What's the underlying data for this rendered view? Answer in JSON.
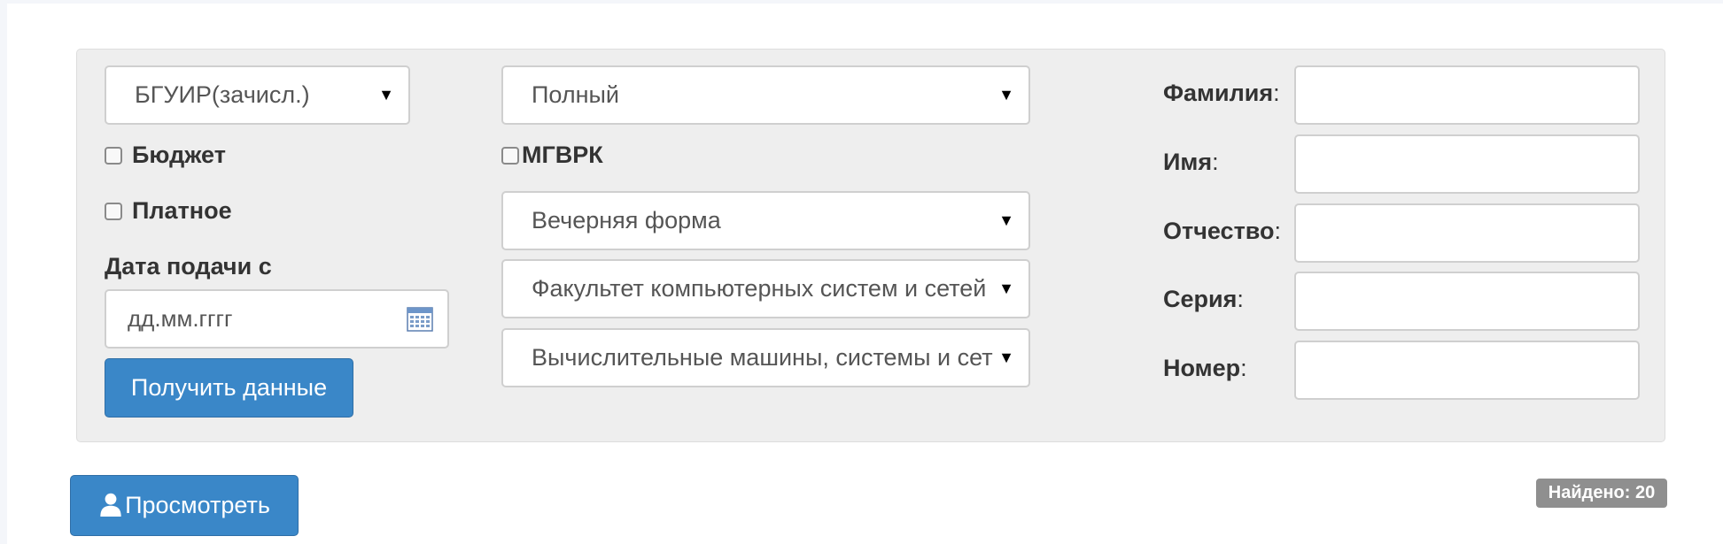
{
  "filters": {
    "institution_select": "БГУИР(зачисл.)",
    "budget_label": "Бюджет",
    "paid_label": "Платное",
    "date_from_label": "Дата подачи с",
    "date_placeholder": "дд.мм.гггг",
    "get_data_button": "Получить данные",
    "mode_select": "Полный",
    "mgvrk_label": "МГВРК",
    "study_form_select": "Вечерняя форма",
    "faculty_select": "Факультет компьютерных систем и сетей",
    "specialty_select": "Вычислительные машины, системы и сети"
  },
  "person_fields": [
    {
      "label": "Фамилия",
      "suffix": ":"
    },
    {
      "label": "Имя",
      "suffix": ":"
    },
    {
      "label": "Отчество",
      "suffix": ":"
    },
    {
      "label": "Серия",
      "suffix": ":"
    },
    {
      "label": "Номер",
      "suffix": ":"
    }
  ],
  "view_button": "Просмотреть",
  "found_badge": "Найдено: 20",
  "icons": {
    "dropdown": "triangle-down",
    "calendar": "calendar-icon",
    "user": "user-icon"
  },
  "colors": {
    "primary": "#3a87c8",
    "panel": "#eeeeee",
    "badge": "#8f8f8f"
  }
}
